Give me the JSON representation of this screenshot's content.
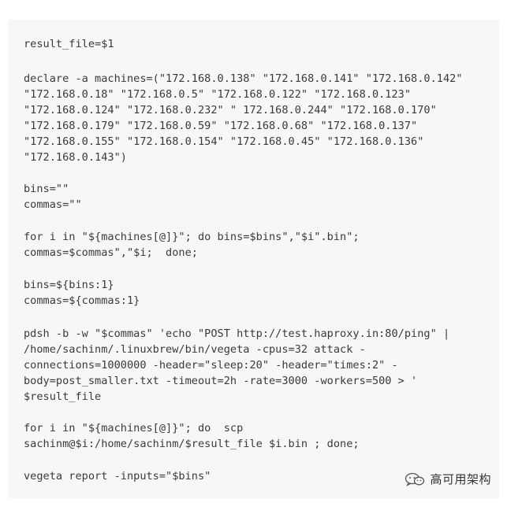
{
  "code_block": {
    "lines": [
      "result_file=$1",
      "declare -a machines=(\"172.168.0.138\" \"172.168.0.141\" \"172.168.0.142\"",
      "\"172.168.0.18\" \"172.168.0.5\" \"172.168.0.122\" \"172.168.0.123\"",
      "\"172.168.0.124\" \"172.168.0.232\" \" 172.168.0.244\" \"172.168.0.170\"",
      "\"172.168.0.179\" \"172.168.0.59\" \"172.168.0.68\" \"172.168.0.137\"",
      "\"172.168.0.155\" \"172.168.0.154\" \"172.168.0.45\" \"172.168.0.136\"",
      "\"172.168.0.143\")",
      "bins=\"\"",
      "commas=\"\"",
      "for i in \"${machines[@]}\"; do bins=$bins\",\"$i\".bin\";",
      "commas=$commas\",\"$i;  done;",
      "bins=${bins:1}",
      "commas=${commas:1}",
      "pdsh -b -w \"$commas\" 'echo \"POST http://test.haproxy.in:80/ping\" |",
      "/home/sachinm/.linuxbrew/bin/vegeta -cpus=32 attack -",
      "connections=1000000 -header=\"sleep:20\" -header=\"times:2\" -",
      "body=post_smaller.txt -timeout=2h -rate=3000 -workers=500 > '",
      "$result_file",
      "for i in \"${machines[@]}\"; do  scp",
      "sachinm@$i:/home/sachinm/$result_file $i.bin ; done;",
      "vegeta report -inputs=\"$bins\""
    ]
  },
  "watermark": {
    "text": "高可用架构",
    "icon": "wechat-icon"
  }
}
